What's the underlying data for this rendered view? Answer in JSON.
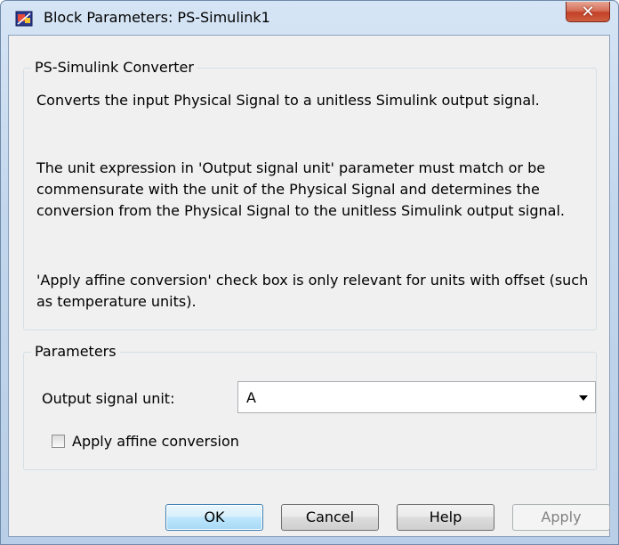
{
  "window": {
    "title": "Block Parameters: PS-Simulink1",
    "close_glyph": "✕"
  },
  "description": {
    "group_title": "PS-Simulink Converter",
    "paragraph_1": "Converts the input Physical Signal to a unitless Simulink output signal.",
    "paragraph_2": "The unit expression in 'Output signal unit' parameter must match or be commensurate with the unit of the Physical Signal and determines the conversion from the Physical Signal to the unitless Simulink output signal.",
    "paragraph_3": "'Apply affine conversion' check box is only relevant for units with offset (such as temperature units)."
  },
  "parameters": {
    "group_title": "Parameters",
    "output_signal_unit_label": "Output signal unit:",
    "output_signal_unit_value": "A",
    "affine_label": "Apply affine conversion",
    "affine_checked": false
  },
  "buttons": {
    "ok": "OK",
    "cancel": "Cancel",
    "help": "Help",
    "apply": "Apply"
  },
  "colors": {
    "title_bar": "#c2d6ec",
    "close_button": "#c34128",
    "dialog_bg": "#f0f0f0",
    "default_button": "#bee6fd"
  },
  "icons": {
    "app": "simulink-block-icon",
    "close": "close-icon",
    "dropdown": "chevron-down-icon"
  }
}
